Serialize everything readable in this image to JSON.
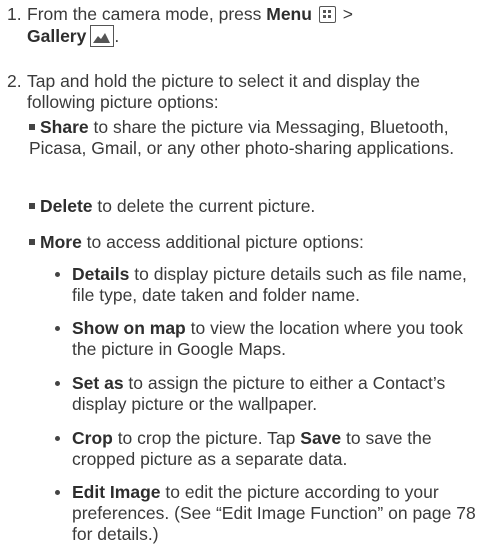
{
  "steps": [
    {
      "number": "1.",
      "prefix": "From the camera mode, press ",
      "menu_bold": "Menu",
      "separator": " >",
      "gallery_bold": "Gallery",
      "end_punct": "."
    },
    {
      "number": "2.",
      "text": "Tap and hold the picture to select it and display the following picture options:"
    }
  ],
  "options": [
    {
      "bold": "Share",
      "text": " to share the picture via Messaging, Bluetooth, Picasa, Gmail, or any other photo-sharing applications."
    },
    {
      "bold": "Delete",
      "text": " to delete the current picture."
    },
    {
      "bold": "More",
      "text": " to access additional picture options:"
    }
  ],
  "more_options": [
    {
      "bold": "Details",
      "text": " to display picture details such as file name, file type, date taken and folder name."
    },
    {
      "bold": "Show on map",
      "text": " to view the location where you took the picture in Google Maps."
    },
    {
      "bold": "Set as",
      "text": " to assign the picture to either a Contact’s display picture or the wallpaper."
    },
    {
      "bold": "Crop",
      "text": " to crop the picture. Tap ",
      "bold2": "Save",
      "text2": " to save the cropped picture as a separate data."
    },
    {
      "bold": "Edit Image",
      "text": " to edit the picture according to your preferences. (See “Edit Image Function” on page 78 for details.)"
    }
  ],
  "icons": {
    "menu_key": "menu-key-icon",
    "gallery": "gallery-icon"
  },
  "colors": {
    "text": "#3a3a3a",
    "bold": "#2e2e2e",
    "icon_stroke": "#555555"
  }
}
